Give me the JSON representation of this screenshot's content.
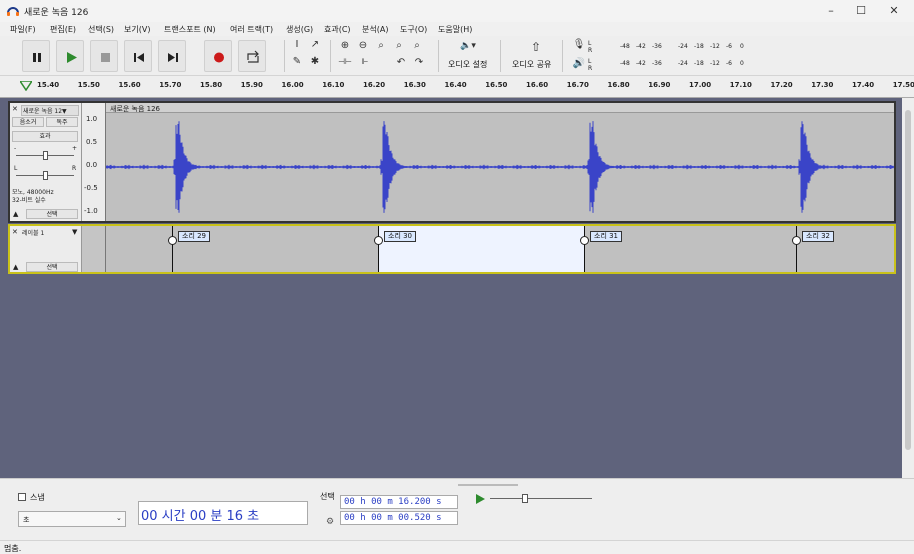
{
  "window": {
    "title": "새로운 녹음 126",
    "min": "–",
    "max": "☐",
    "close": "✕"
  },
  "menu": [
    "파일(F)",
    "편집(E)",
    "선택(S)",
    "보기(V)",
    "트랜스포트 (N)",
    "여러 트랙(T)",
    "생성(G)",
    "효과(C)",
    "분석(A)",
    "도구(O)",
    "도움말(H)"
  ],
  "toolbar": {
    "audio_setup": "오디오 설정",
    "share_audio": "오디오 공유"
  },
  "meter": {
    "ticks": [
      "-48",
      "-42",
      "-36",
      "-24",
      "-18",
      "-12",
      "-6",
      "0"
    ],
    "rec_channels": [
      "L",
      "R"
    ],
    "play_channels": [
      "L",
      "R"
    ]
  },
  "ruler": {
    "ticks": [
      "15.40",
      "15.50",
      "15.60",
      "15.70",
      "15.80",
      "15.90",
      "16.00",
      "16.10",
      "16.20",
      "16.30",
      "16.40",
      "16.50",
      "16.60",
      "16.70",
      "16.80",
      "16.90",
      "17.00",
      "17.10",
      "17.20",
      "17.30",
      "17.40",
      "17.50"
    ]
  },
  "audio_track": {
    "name": "새로운 녹음 12▼",
    "clip_name": "새로운 녹음 126",
    "mute": "음소거",
    "solo": "독주",
    "effects": "효과",
    "gain_minus": "-",
    "gain_plus": "+",
    "pan_l": "L",
    "pan_r": "R",
    "info_rate": "모노, 48000Hz",
    "info_format": "32-비트 실수",
    "select": "선택",
    "scale": [
      "1.0",
      "0.5",
      "0.0",
      "-0.5",
      "-1.0"
    ]
  },
  "label_track": {
    "name": "레이블 1",
    "select": "선택",
    "labels": [
      "소리 29",
      "소리 30",
      "소리 31",
      "소리 32"
    ]
  },
  "bottom": {
    "snap": "스냅",
    "snap_unit": "초",
    "time_display": "00 시간 00 분 16 초",
    "selection_label": "선택",
    "sel_start": "00 h 00 m 16.200 s",
    "sel_length": "00 h 00 m 00.520 s"
  },
  "status": "멈춤."
}
